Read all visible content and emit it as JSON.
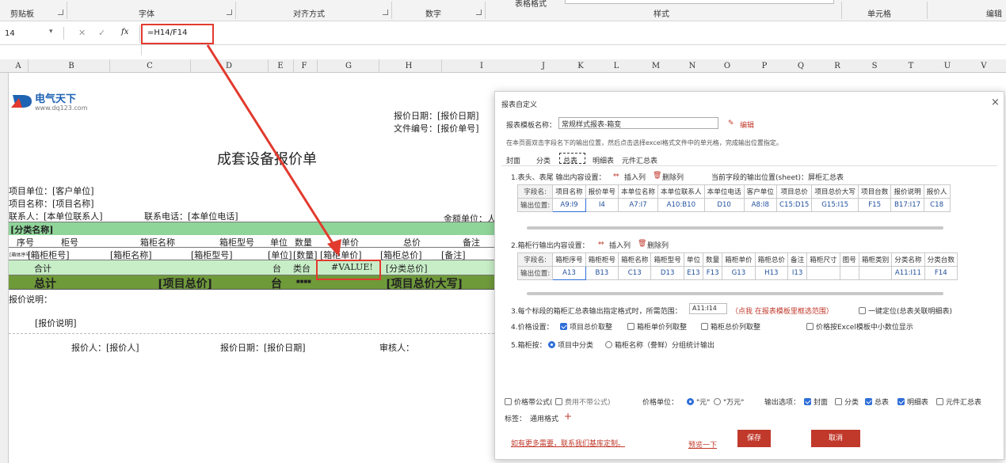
{
  "ribbon": {
    "groups": [
      "剪贴板",
      "字体",
      "对齐方式",
      "数字",
      "样式",
      "单元格",
      "编辑"
    ],
    "top_fragments": [
      "表格格式",
      "(单元格)"
    ]
  },
  "formula_bar": {
    "name_box": "14",
    "fx": "fx",
    "formula": "=H14/F14"
  },
  "columns": [
    "A",
    "B",
    "C",
    "D",
    "E",
    "F",
    "G",
    "H",
    "I",
    "J",
    "K",
    "L",
    "M",
    "N",
    "O",
    "P",
    "Q",
    "R",
    "S",
    "T",
    "U",
    "V"
  ],
  "sheet": {
    "logo_cn": "电气天下",
    "logo_url": "www.dq123.com",
    "quote_date": "报价日期：[报价日期]",
    "file_no": "文件编号：[报价单号]",
    "title": "成套设备报价单",
    "project_unit": "项目单位：[客户单位]",
    "project_name": "项目名称：[项目名称]",
    "contact": "联系人：[本单位联系人]",
    "phone": "联系电话：[本单位电话]",
    "amount_unit": "金额单位：人",
    "category": "[分类名称]",
    "headers": [
      "序号",
      "柜号",
      "箱柜名称",
      "箱柜型号",
      "单位",
      "数量",
      "单价",
      "总价",
      "备注"
    ],
    "row": [
      "[箱体序号]",
      "[箱柜柜号]",
      "[箱柜名称]",
      "[箱柜型号]",
      "[单位]",
      "[数量]",
      "[箱柜单价]",
      "[箱柜总价]",
      "[备注]"
    ],
    "subtotal": [
      "合计",
      "台",
      "类台",
      "#VALUE!",
      "[分类总价]"
    ],
    "total": [
      "总计",
      "[项目总价]",
      "台",
      "■■■■",
      "[项目总价大写]"
    ],
    "remarks_title": "报价说明：",
    "remarks": "[报价说明]",
    "footer": [
      "报价人：[报价人]",
      "报价日期：[报价日期]",
      "审核人："
    ]
  },
  "dialog": {
    "title": "报表自定义",
    "close": "×",
    "template_label": "报表模板名称：",
    "template_value": "常规样式报表-箱变",
    "edit": "编辑",
    "hint": "在本页面双击字段名下的输出位置，然后点击选择excel格式文件中的单元格，完成输出位置指定。",
    "tabs": [
      "封面",
      "分类",
      "总表",
      "明细表",
      "元件汇总表"
    ],
    "active_tab": "总表",
    "section1": {
      "title": "1.表头、表尾 输出内容设置：",
      "insert": "插入列",
      "delete": "删除列",
      "current": "当前字段的输出位置(sheet)：屏柜汇总表",
      "names": [
        "字段名:",
        "项目名称",
        "报价单号",
        "本单位名称",
        "本单位联系人",
        "本单位电话",
        "客户单位",
        "项目总价",
        "项目总价大写",
        "项目台数",
        "报价说明",
        "报价人"
      ],
      "positions": [
        "输出位置:",
        "A9:I9",
        "I4",
        "A7:I7",
        "A10:B10",
        "D10",
        "A8:I8",
        "C15:D15",
        "G15:I15",
        "F15",
        "B17:I17",
        "C18"
      ]
    },
    "section2": {
      "title": "2.箱柜行输出内容设置：",
      "insert": "插入列",
      "delete": "删除列",
      "names": [
        "字段名:",
        "箱柜序号",
        "箱柜柜号",
        "箱柜名称",
        "箱柜型号",
        "单位",
        "数量",
        "箱柜单价",
        "箱柜总价",
        "备注",
        "箱柜尺寸",
        "图号",
        "箱柜类别",
        "分类名称",
        "分类台数"
      ],
      "positions": [
        "输出位置:",
        "A13",
        "B13",
        "C13",
        "D13",
        "E13",
        "F13",
        "G13",
        "H13",
        "I13",
        "",
        "",
        "",
        "A11:I11",
        "F14"
      ]
    },
    "opt3_text": "3.每个标段的箱柜汇总表输出指定格式时，所需范围：",
    "opt3_range": "A11:I14",
    "opt3_link": "（点我 在报表模板里框选范围）",
    "opt3_check": "一键定位(总表关联明细表)",
    "opt4_label": "4.价格设置：",
    "opt4_items": [
      "项目总价取整",
      "箱柜单价列取整",
      "箱柜总价列取整",
      "价格按Excel模板中小数位显示"
    ],
    "opt5_label": "5.箱柜按：",
    "opt5_items": [
      "项目中分类",
      "箱柜名称（誊鲜）分组统计输出"
    ],
    "price_formula": "价格带公式(",
    "fee_formula": "费用不带公式)",
    "price_unit_label": "价格单位：",
    "unit_yuan": "\"元\"",
    "unit_wan": "\"万元\"",
    "output_label": "输出选项：",
    "output_items": [
      "封面",
      "分类",
      "总表",
      "明细表",
      "元件汇总表"
    ],
    "tag_label": "标签：",
    "tag_value": "通用格式",
    "tag_add": "+",
    "more_link": "如有更多需要，联系我们基库定制。",
    "preview": "预览一下",
    "save": "保存",
    "cancel": "取消"
  }
}
